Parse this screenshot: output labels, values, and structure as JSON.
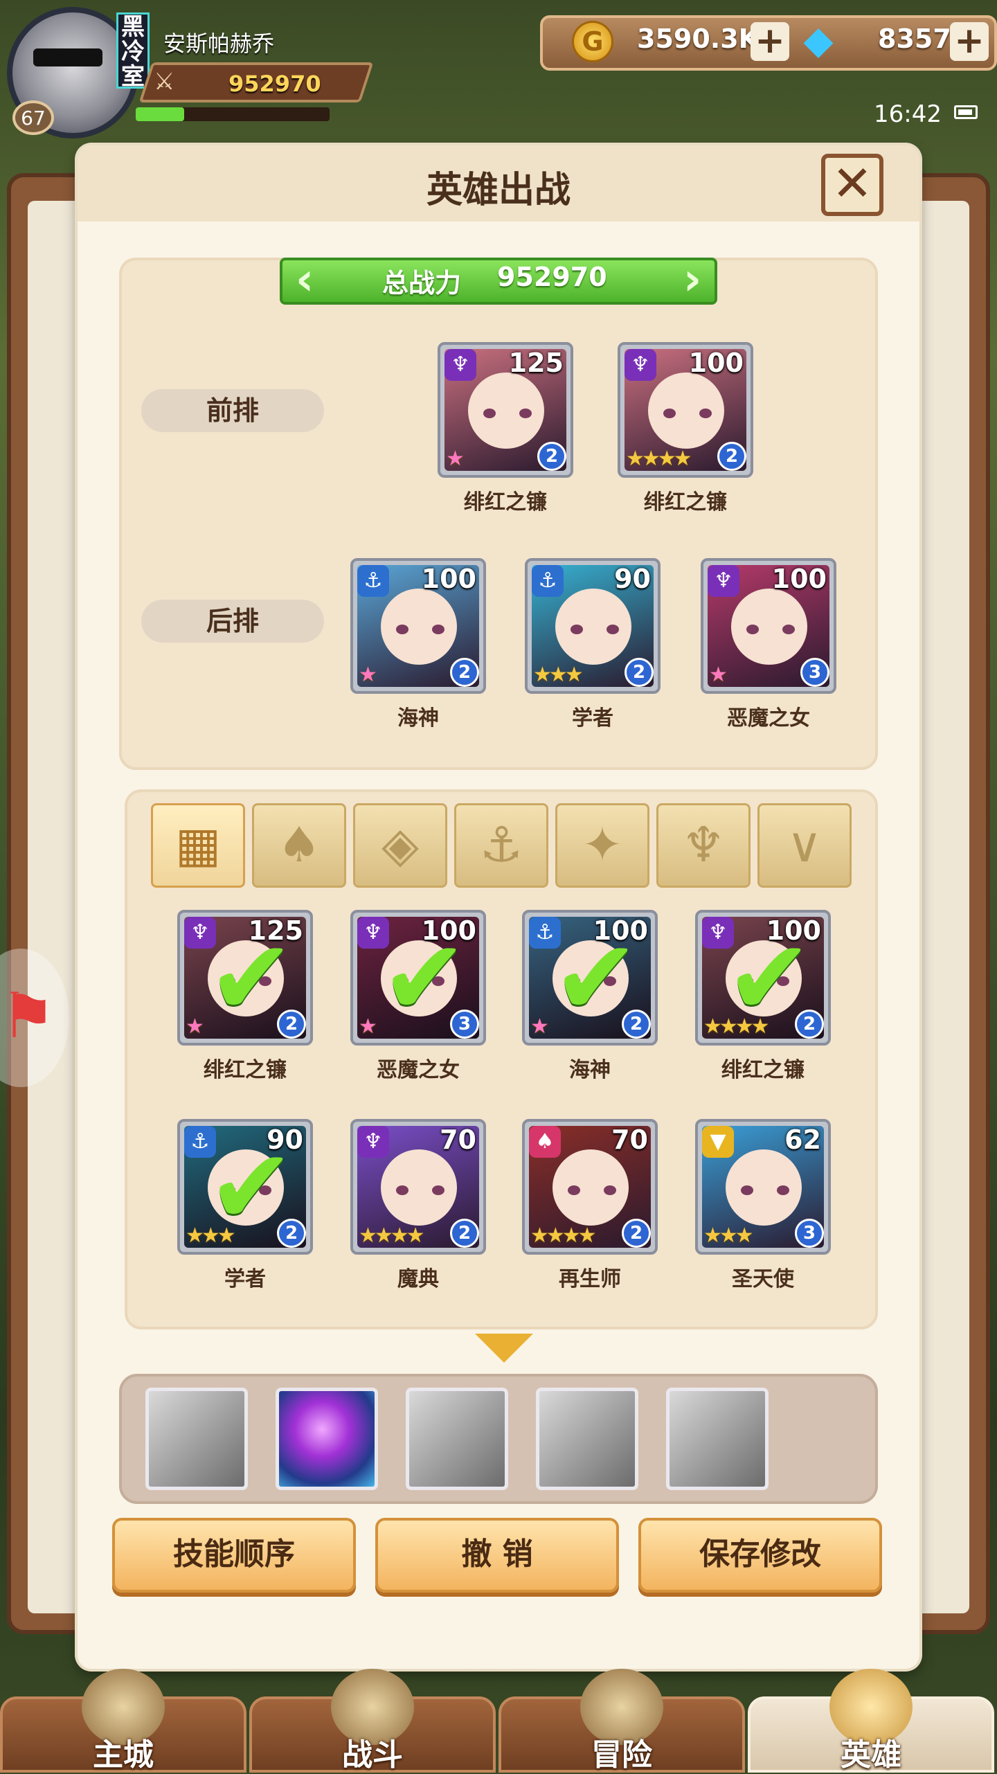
{
  "player": {
    "name": "安斯帕赫乔",
    "level": "67",
    "guild_tag": "黑冷室",
    "power": "952970",
    "xp_fraction": 0.25
  },
  "resources": {
    "gold": "3590.3K",
    "gems": "8357",
    "coin_glyph": "G",
    "plus": "+"
  },
  "status": {
    "time": "16:42"
  },
  "dialog": {
    "title": "英雄出战",
    "close_glyph": "✕",
    "total_label": "总战力",
    "total_value": "952970",
    "front_row_label": "前排",
    "back_row_label": "后排"
  },
  "front_row": [
    {
      "name": "绯红之镰",
      "level": "125",
      "faction": "demon",
      "stars": "★",
      "rainbow": true,
      "rank": "2",
      "color": "#c9707f"
    },
    {
      "name": "绯红之镰",
      "level": "100",
      "faction": "demon",
      "stars": "★★★★",
      "rainbow": false,
      "rank": "2",
      "color": "#c9707f"
    }
  ],
  "back_row": [
    {
      "name": "海神",
      "level": "100",
      "faction": "ocean",
      "stars": "★",
      "rainbow": true,
      "rank": "2",
      "color": "#5aa6d6"
    },
    {
      "name": "学者",
      "level": "90",
      "faction": "ocean",
      "stars": "★★★",
      "rainbow": false,
      "rank": "2",
      "color": "#36b2d2"
    },
    {
      "name": "恶魔之女",
      "level": "100",
      "faction": "demon",
      "stars": "★",
      "rainbow": true,
      "rank": "3",
      "color": "#b53a6a"
    }
  ],
  "filters": [
    {
      "icon": "all-grid-icon",
      "glyph": "▦",
      "active": true
    },
    {
      "icon": "forest-faction-icon",
      "glyph": "♠",
      "active": false
    },
    {
      "icon": "diamond-faction-icon",
      "glyph": "◈",
      "active": false
    },
    {
      "icon": "anchor-faction-icon",
      "glyph": "⚓",
      "active": false
    },
    {
      "icon": "beast-faction-icon",
      "glyph": "✦",
      "active": false
    },
    {
      "icon": "demon-faction-icon",
      "glyph": "♆",
      "active": false
    },
    {
      "icon": "angel-faction-icon",
      "glyph": "∨",
      "active": false
    }
  ],
  "roster": [
    {
      "name": "绯红之镰",
      "level": "125",
      "faction": "demon",
      "stars": "★",
      "rainbow": true,
      "rank": "2",
      "selected": true,
      "color": "#c9707f"
    },
    {
      "name": "恶魔之女",
      "level": "100",
      "faction": "demon",
      "stars": "★",
      "rainbow": true,
      "rank": "3",
      "selected": true,
      "color": "#b53a6a"
    },
    {
      "name": "海神",
      "level": "100",
      "faction": "ocean",
      "stars": "★",
      "rainbow": true,
      "rank": "2",
      "selected": true,
      "color": "#5aa6d6"
    },
    {
      "name": "绯红之镰",
      "level": "100",
      "faction": "demon",
      "stars": "★★★★",
      "rainbow": false,
      "rank": "2",
      "selected": true,
      "color": "#c9707f"
    },
    {
      "name": "学者",
      "level": "90",
      "faction": "ocean",
      "stars": "★★★",
      "rainbow": false,
      "rank": "2",
      "selected": true,
      "color": "#36b2d2"
    },
    {
      "name": "魔典",
      "level": "70",
      "faction": "demon",
      "stars": "★★★★",
      "rainbow": false,
      "rank": "2",
      "selected": false,
      "color": "#7a4ec8"
    },
    {
      "name": "再生师",
      "level": "70",
      "faction": "forest",
      "stars": "★★★★",
      "rainbow": false,
      "rank": "2",
      "selected": false,
      "color": "#8a2e28"
    },
    {
      "name": "圣天使",
      "level": "62",
      "faction": "angel",
      "stars": "★★★",
      "rainbow": false,
      "rank": "3",
      "selected": false,
      "color": "#3a9fd8"
    }
  ],
  "faction_colors": {
    "demon": "#7a2fb8",
    "ocean": "#2c6fcf",
    "forest": "#d6366a",
    "angel": "#e8b420"
  },
  "faction_glyphs": {
    "demon": "♆",
    "ocean": "⚓",
    "forest": "♠",
    "angel": "▼"
  },
  "check_glyph": "✔",
  "skills": [
    {
      "icon": "leaf-skill-icon",
      "active": false
    },
    {
      "icon": "purple-orb-skill-icon",
      "active": true
    },
    {
      "icon": "storm-skill-icon",
      "active": false
    },
    {
      "icon": "beast-skill-icon",
      "active": false
    },
    {
      "icon": "angel-skill-icon",
      "active": false
    }
  ],
  "buttons": {
    "skill_order": "技能顺序",
    "undo": "撤 销",
    "save": "保存修改"
  },
  "nav": [
    {
      "label": "主城",
      "active": false
    },
    {
      "label": "战斗",
      "active": false
    },
    {
      "label": "冒险",
      "active": false
    },
    {
      "label": "英雄",
      "active": true
    }
  ]
}
